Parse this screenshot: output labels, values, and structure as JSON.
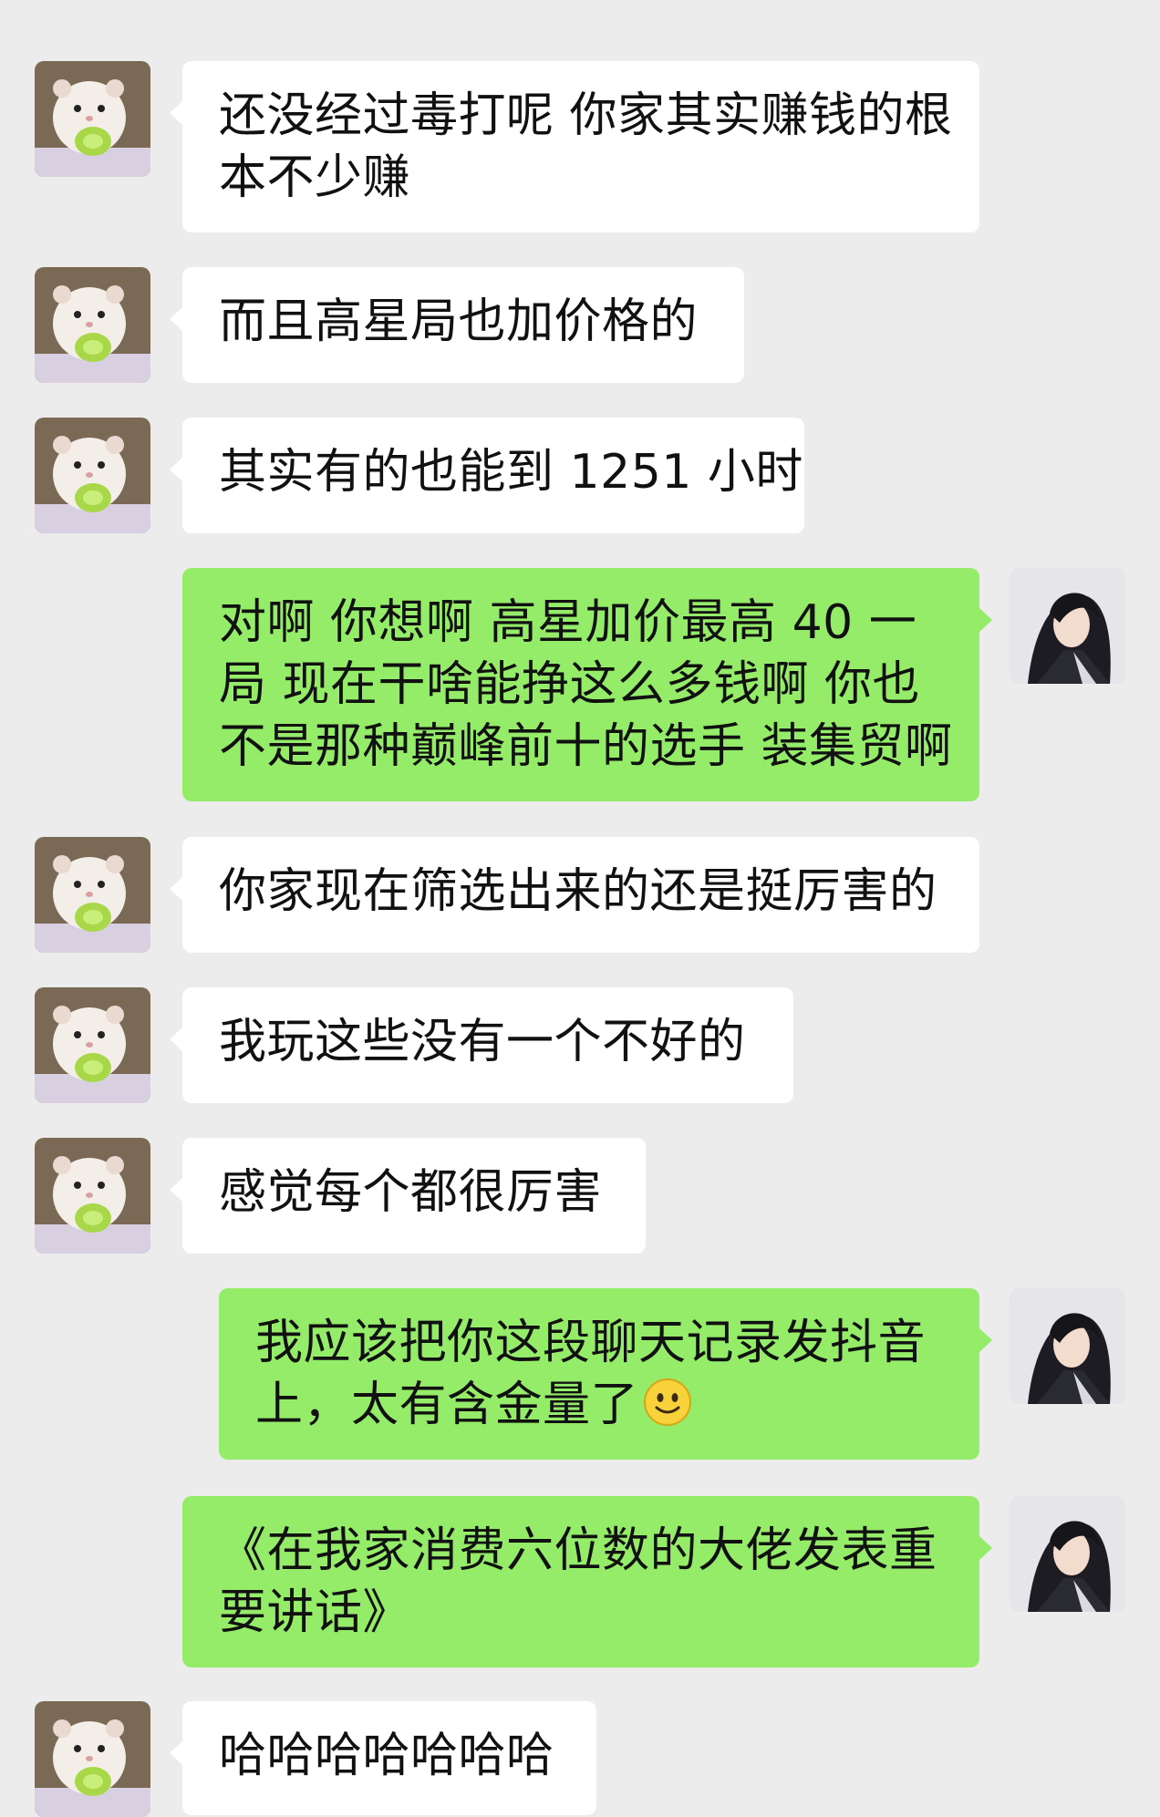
{
  "conversation": {
    "messages": [
      {
        "side": "in",
        "lines": [
          "还没经过毒打呢 你家其实赚钱的根",
          "本不少赚"
        ]
      },
      {
        "side": "in",
        "lines": [
          "而且高星局也加价格的"
        ]
      },
      {
        "side": "in",
        "lines": [
          "其实有的也能到 1251 小时"
        ]
      },
      {
        "side": "out",
        "lines": [
          "对啊 你想啊 高星加价最高 40 一",
          "局  现在干啥能挣这么多钱啊  你也",
          "不是那种巅峰前十的选手 装集贸啊"
        ]
      },
      {
        "side": "in",
        "lines": [
          "你家现在筛选出来的还是挺厉害的"
        ]
      },
      {
        "side": "in",
        "lines": [
          "我玩这些没有一个不好的"
        ]
      },
      {
        "side": "in",
        "lines": [
          "感觉每个都很厉害"
        ]
      },
      {
        "side": "out",
        "lines": [
          "我应该把你这段聊天记录发抖音",
          "上，太有含金量了"
        ],
        "emoji": "smile-emoji"
      },
      {
        "side": "out",
        "lines": [
          "《在我家消费六位数的大佬发表重",
          "要讲话》"
        ]
      },
      {
        "side": "in",
        "lines": [
          "哈哈哈哈哈哈哈"
        ]
      }
    ]
  },
  "colors": {
    "background": "#ececec",
    "incoming_bubble": "#ffffff",
    "outgoing_bubble": "#95ec69"
  },
  "icons": {
    "incoming_avatar": "hamster-avatar",
    "outgoing_avatar": "anime-swordsman-avatar"
  }
}
